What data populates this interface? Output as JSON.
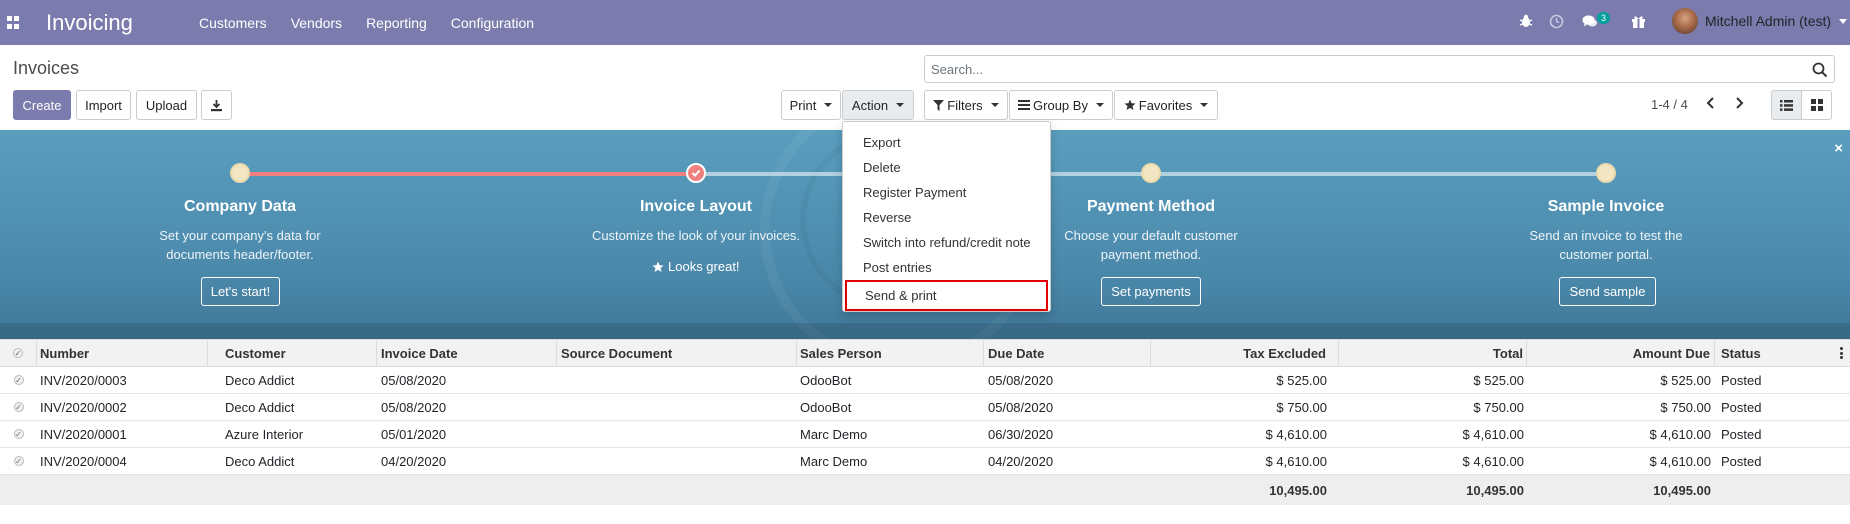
{
  "app": {
    "title": "Invoicing",
    "menu": [
      "Customers",
      "Vendors",
      "Reporting",
      "Configuration"
    ],
    "user": "Mitchell Admin (test)",
    "chat_badge": "3"
  },
  "page": {
    "title": "Invoices",
    "buttons": {
      "create": "Create",
      "import": "Import",
      "upload": "Upload",
      "print": "Print",
      "action": "Action"
    },
    "search_placeholder": "Search...",
    "filters": "Filters",
    "group_by": "Group By",
    "favorites": "Favorites",
    "pager": "1-4 / 4"
  },
  "onboarding": {
    "steps": [
      {
        "title": "Company Data",
        "desc1": "Set your company's data for",
        "desc2": "documents header/footer.",
        "button": "Let's start!",
        "done": false
      },
      {
        "title": "Invoice Layout",
        "desc1": "Customize the look of your invoices.",
        "desc2": "",
        "status": "Looks great!",
        "done": true
      },
      {
        "title": "Payment Method",
        "desc1": "Choose your default customer",
        "desc2": "payment method.",
        "button": "Set payments",
        "done": false
      },
      {
        "title": "Sample Invoice",
        "desc1": "Send an invoice to test the",
        "desc2": "customer portal.",
        "button": "Send sample",
        "done": false
      }
    ],
    "close": "×"
  },
  "action_menu": {
    "items": [
      "Export",
      "Delete",
      "Register Payment",
      "Reverse",
      "Switch into refund/credit note",
      "Post entries",
      "Send & print"
    ]
  },
  "table": {
    "headers": [
      "Number",
      "Customer",
      "Invoice Date",
      "Source Document",
      "Sales Person",
      "Due Date",
      "Tax Excluded",
      "Total",
      "Amount Due",
      "Status"
    ],
    "rows": [
      {
        "number": "INV/2020/0003",
        "customer": "Deco Addict",
        "invoice_date": "05/08/2020",
        "source": "",
        "sales_person": "OdooBot",
        "due_date": "05/08/2020",
        "tax_excluded": "$ 525.00",
        "total": "$ 525.00",
        "amount_due": "$ 525.00",
        "status": "Posted"
      },
      {
        "number": "INV/2020/0002",
        "customer": "Deco Addict",
        "invoice_date": "05/08/2020",
        "source": "",
        "sales_person": "OdooBot",
        "due_date": "05/08/2020",
        "tax_excluded": "$ 750.00",
        "total": "$ 750.00",
        "amount_due": "$ 750.00",
        "status": "Posted"
      },
      {
        "number": "INV/2020/0001",
        "customer": "Azure Interior",
        "invoice_date": "05/01/2020",
        "source": "",
        "sales_person": "Marc Demo",
        "due_date": "06/30/2020",
        "tax_excluded": "$ 4,610.00",
        "total": "$ 4,610.00",
        "amount_due": "$ 4,610.00",
        "status": "Posted"
      },
      {
        "number": "INV/2020/0004",
        "customer": "Deco Addict",
        "invoice_date": "04/20/2020",
        "source": "",
        "sales_person": "Marc Demo",
        "due_date": "04/20/2020",
        "tax_excluded": "$ 4,610.00",
        "total": "$ 4,610.00",
        "amount_due": "$ 4,610.00",
        "status": "Posted"
      }
    ],
    "totals": {
      "tax_excluded": "10,495.00",
      "total": "10,495.00",
      "amount_due": "10,495.00"
    }
  },
  "colors": {
    "brand": "#7c7bad",
    "banner": "#5a9ebf",
    "highlight": "#e00000",
    "progress_done": "#f0807f"
  }
}
